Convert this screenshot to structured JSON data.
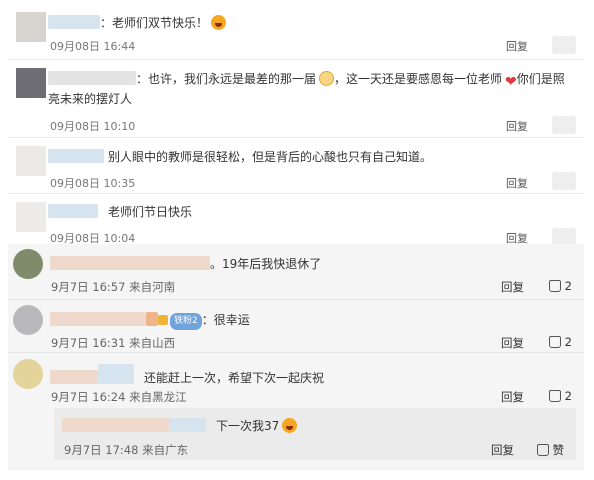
{
  "comments_top": [
    {
      "text": "：老师们双节快乐！",
      "time": "09月08日 16:44",
      "reply": "回复",
      "emoji": "laughing-face-icon"
    },
    {
      "text_a": "：也许，我们永远是最差的那一届",
      "text_b": "，这一天还是要感恩每一位老师",
      "text_c": "你们是照亮未来的摆灯人",
      "time": "09月08日 10:10",
      "reply": "回复"
    },
    {
      "text": "别人眼中的教师是很轻松，但是背后的心酸也只有自己知道。",
      "time": "09月08日 10:35",
      "reply": "回复"
    },
    {
      "text": "老师们节日快乐",
      "time": "09月08日 10:04",
      "reply": "回复"
    }
  ],
  "comments_bottom": [
    {
      "text": "。19年后我快退休了",
      "time": "9月7日 16:57 来自河南",
      "reply": "回复",
      "likes": "2"
    },
    {
      "badge": "铁粉2",
      "text": "：很幸运",
      "time": "9月7日 16:31 来自山西",
      "reply": "回复",
      "likes": "2"
    },
    {
      "text": "还能赶上一次，希望下次一起庆祝",
      "time": "9月7日 16:24 来自黑龙江",
      "reply": "回复",
      "likes": "2"
    }
  ],
  "sub_reply": {
    "text": "下一次我37",
    "time": "9月7日 17:48 来自广东",
    "reply": "回复",
    "like_label": "赞"
  },
  "colors": {
    "heart": "#e0393e",
    "section_bg": "#f5f5f5",
    "sub_bg": "#ebebeb"
  }
}
